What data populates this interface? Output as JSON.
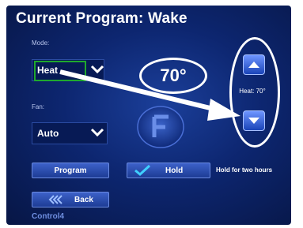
{
  "header": {
    "title": "Current Program: Wake"
  },
  "mode": {
    "label": "Mode:",
    "value": "Heat"
  },
  "fan": {
    "label": "Fan:",
    "value": "Auto"
  },
  "temperature": {
    "display": "70°"
  },
  "setpoint": {
    "label": "Heat: 70°"
  },
  "buttons": {
    "program": "Program",
    "hold": "Hold",
    "back": "Back"
  },
  "hold_note": "Hold for two hours",
  "brand": {
    "name": "Control4"
  },
  "colors": {
    "accent": "#3d61c9",
    "highlight": "#1fa82e",
    "annotation": "#ffffff"
  }
}
